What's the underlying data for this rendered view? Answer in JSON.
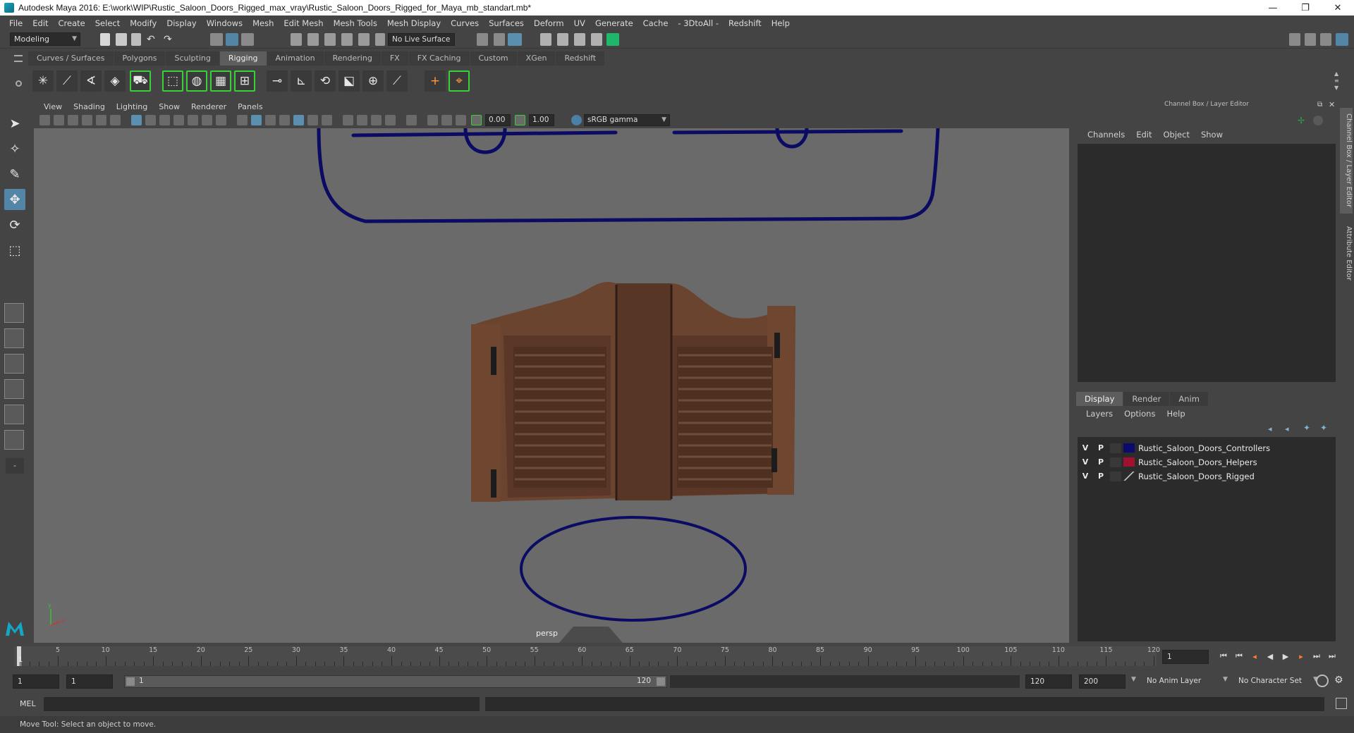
{
  "window": {
    "title": "Autodesk Maya 2016: E:\\work\\WIP\\Rustic_Saloon_Doors_Rigged_max_vray\\Rustic_Saloon_Doors_Rigged_for_Maya_mb_standart.mb*",
    "minimize": "—",
    "maximize": "❐",
    "close": "✕"
  },
  "menubar": [
    "File",
    "Edit",
    "Create",
    "Select",
    "Modify",
    "Display",
    "Windows",
    "Mesh",
    "Edit Mesh",
    "Mesh Tools",
    "Mesh Display",
    "Curves",
    "Surfaces",
    "Deform",
    "UV",
    "Generate",
    "Cache",
    "- 3DtoAll -",
    "Redshift",
    "Help"
  ],
  "status": {
    "mode": "Modeling",
    "live_surface": "No Live Surface"
  },
  "shelf": {
    "tabs": [
      "Curves / Surfaces",
      "Polygons",
      "Sculpting",
      "Rigging",
      "Animation",
      "Rendering",
      "FX",
      "FX Caching",
      "Custom",
      "XGen",
      "Redshift"
    ],
    "active_tab": "Rigging"
  },
  "viewport": {
    "menus": [
      "View",
      "Shading",
      "Lighting",
      "Show",
      "Renderer",
      "Panels"
    ],
    "near_value": "0.00",
    "far_value": "1.00",
    "color_space": "sRGB gamma",
    "camera_label": "persp",
    "axis_x": "x",
    "axis_y": "y",
    "background": "#6a6a6a",
    "controller_color": "#0b0b63"
  },
  "channel_box": {
    "title": "Channel Box / Layer Editor",
    "menus": [
      "Channels",
      "Edit",
      "Object",
      "Show"
    ]
  },
  "side_tabs": [
    "Channel Box / Layer Editor",
    "Attribute Editor"
  ],
  "layer_editor": {
    "tabs": [
      "Display",
      "Render",
      "Anim"
    ],
    "active_tab": "Display",
    "menus": [
      "Layers",
      "Options",
      "Help"
    ],
    "layers": [
      {
        "v": "V",
        "p": "P",
        "color": "#0b0b6e",
        "name": "Rustic_Saloon_Doors_Controllers"
      },
      {
        "v": "V",
        "p": "P",
        "color": "#a3102e",
        "name": "Rustic_Saloon_Doors_Helpers"
      },
      {
        "v": "V",
        "p": "P",
        "color": "",
        "name": "Rustic_Saloon_Doors_Rigged"
      }
    ]
  },
  "timeline": {
    "start": "1",
    "ticks": [
      "5",
      "10",
      "15",
      "20",
      "25",
      "30",
      "35",
      "40",
      "45",
      "50",
      "55",
      "60",
      "65",
      "70",
      "75",
      "80",
      "85",
      "90",
      "95",
      "100",
      "105",
      "110",
      "115",
      "120"
    ],
    "current_frame": "1"
  },
  "range": {
    "start": "1",
    "playback_start": "1",
    "slider_start": "1",
    "slider_end": "120",
    "playback_end": "120",
    "end": "200",
    "anim_layer": "No Anim Layer",
    "character_set": "No Character Set"
  },
  "command_line": {
    "label": "MEL"
  },
  "help_line": "Move Tool: Select an object to move."
}
